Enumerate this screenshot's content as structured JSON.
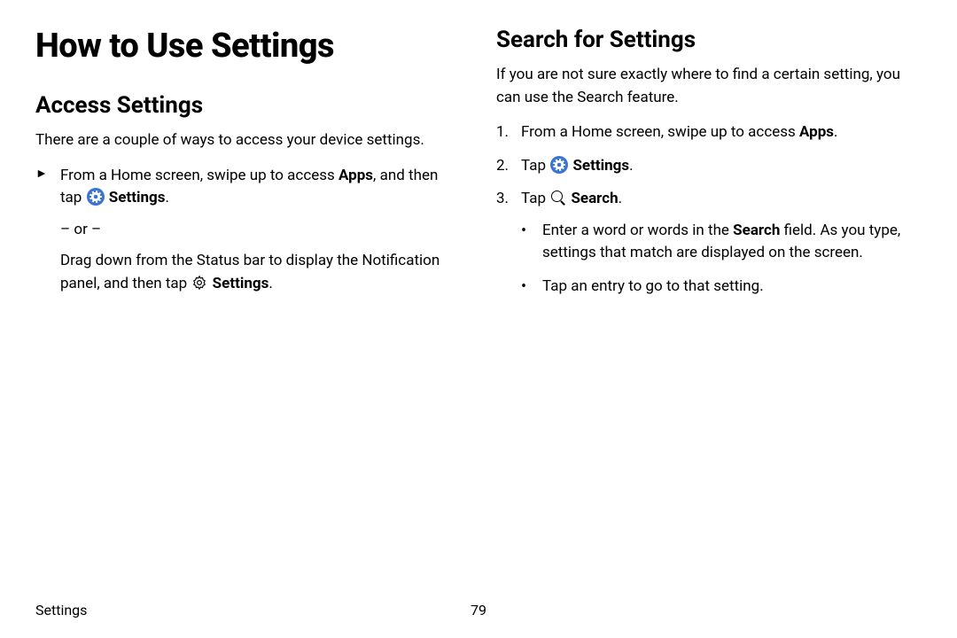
{
  "title": "How to Use Settings",
  "left": {
    "heading": "Access Settings",
    "intro": "There are a couple of ways to access your device settings.",
    "step_pre": "From a Home screen, swipe up to access ",
    "apps_bold": "Apps",
    "step_mid": ", and then tap ",
    "settings_bold": "Settings",
    "step_end": ".",
    "or_sep": "– or –",
    "alt_pre": "Drag down from the Status bar to display the Notification panel, and then tap ",
    "alt_settings_bold": "Settings",
    "alt_end": "."
  },
  "right": {
    "heading": "Search for Settings",
    "intro": "If you are not sure exactly where to find a certain setting, you can use the Search feature.",
    "steps": {
      "s1_pre": "From a Home screen, swipe up to access ",
      "s1_apps": "Apps",
      "s1_end": ".",
      "s2_pre": "Tap ",
      "s2_settings": "Settings",
      "s2_end": ".",
      "s3_pre": "Tap ",
      "s3_search": "Search",
      "s3_end": ".",
      "sub1_pre": "Enter a word or words in the ",
      "sub1_search": "Search",
      "sub1_post": " field. As you type, settings that match are displayed on the screen.",
      "sub2": "Tap an entry to go to that setting."
    }
  },
  "footer": {
    "section": "Settings",
    "page": "79"
  }
}
